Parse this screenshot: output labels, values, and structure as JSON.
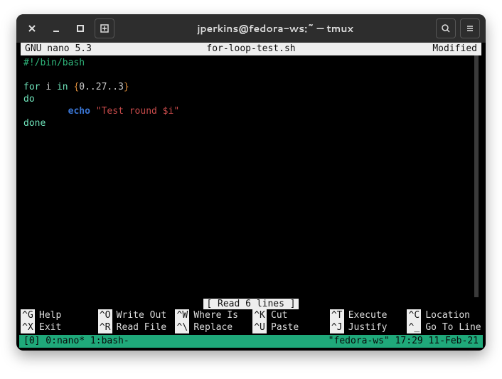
{
  "title": "jperkins@fedora-ws:~ — tmux",
  "nano": {
    "version": "GNU nano 5.3",
    "filename": "for-loop-test.sh",
    "state": "Modified",
    "status_message": "[ Read 6 lines ]"
  },
  "code": {
    "shebang": "#!/bin/bash",
    "for": "for",
    "var": "i",
    "in": "in",
    "range_open": "{",
    "range_body": "0..27..3",
    "range_close": "}",
    "do": "do",
    "indent": "        ",
    "echo": "echo",
    "string": "\"Test round $i\"",
    "done": "done"
  },
  "shortcuts": {
    "row1": [
      {
        "key": "^G",
        "label": "Help"
      },
      {
        "key": "^O",
        "label": "Write Out"
      },
      {
        "key": "^W",
        "label": "Where Is"
      },
      {
        "key": "^K",
        "label": "Cut"
      },
      {
        "key": "^T",
        "label": "Execute"
      },
      {
        "key": "^C",
        "label": "Location"
      }
    ],
    "row2": [
      {
        "key": "^X",
        "label": "Exit"
      },
      {
        "key": "^R",
        "label": "Read File"
      },
      {
        "key": "^\\",
        "label": "Replace"
      },
      {
        "key": "^U",
        "label": "Paste"
      },
      {
        "key": "^J",
        "label": "Justify"
      },
      {
        "key": "^_",
        "label": "Go To Line"
      }
    ]
  },
  "tmux": {
    "left": "[0] 0:nano* 1:bash-",
    "right": "\"fedora-ws\" 17:29 11-Feb-21"
  }
}
